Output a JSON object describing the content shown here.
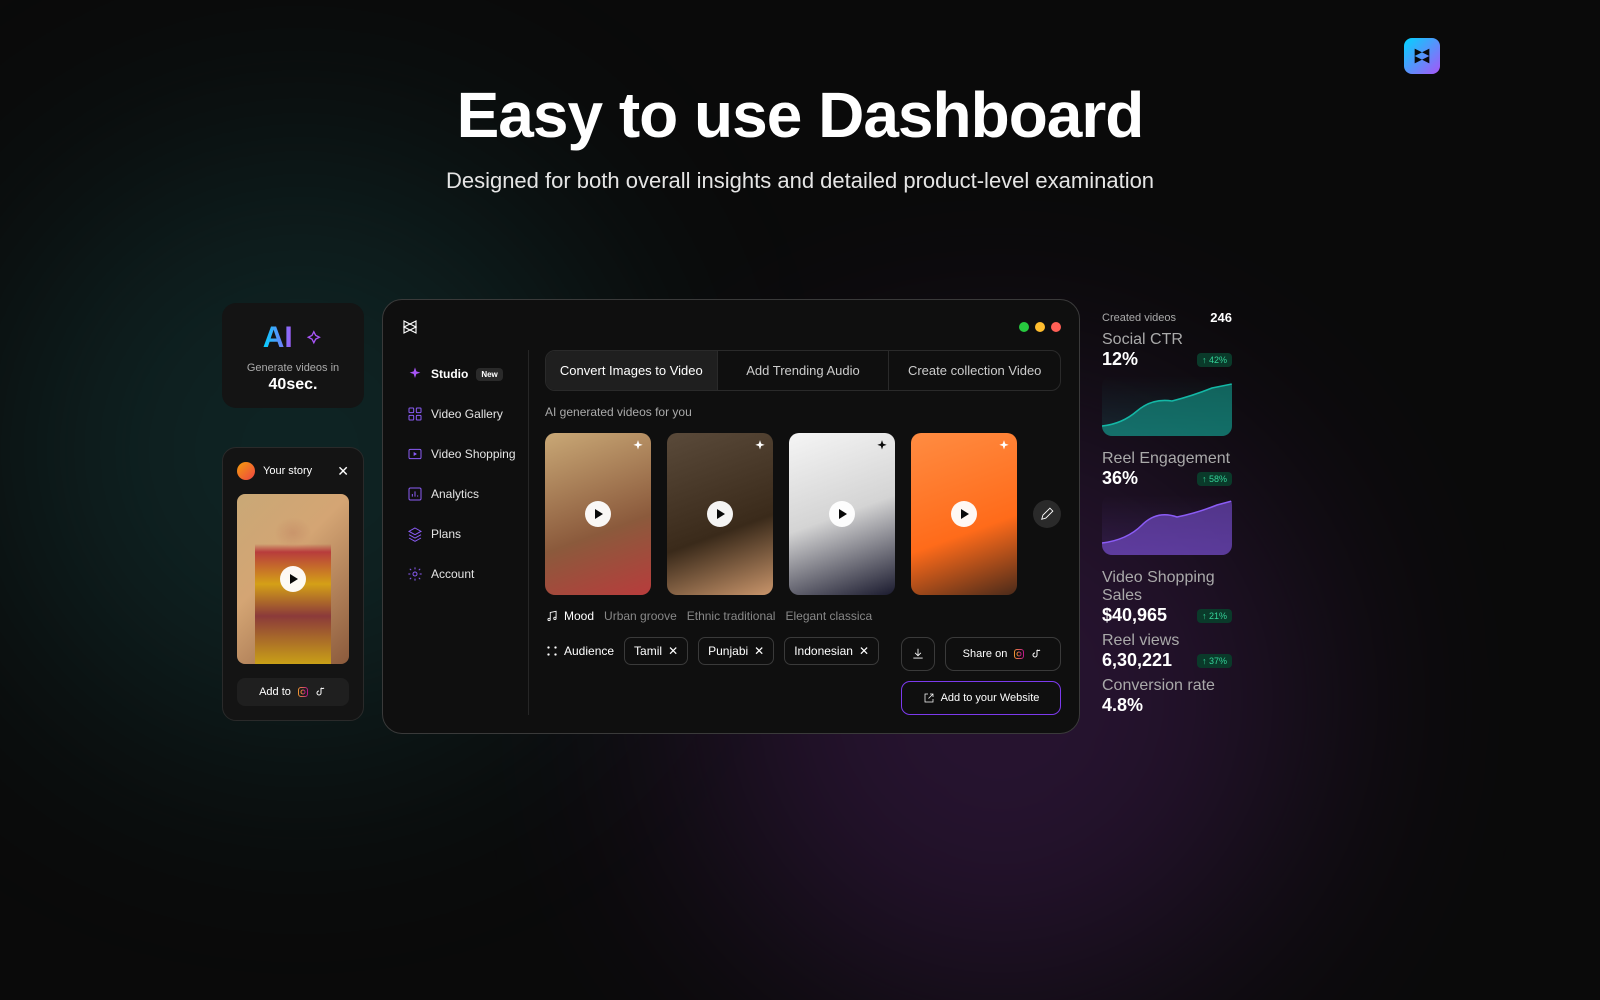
{
  "hero": {
    "title": "Easy to use Dashboard",
    "subtitle": "Designed for both overall insights and detailed product-level examination"
  },
  "ai_card": {
    "badge": "AI",
    "line1": "Generate videos in",
    "line2": "40sec."
  },
  "story": {
    "title": "Your story",
    "addto": "Add to"
  },
  "sidebar": {
    "items": [
      {
        "label": "Studio",
        "badge": "New",
        "icon": "sparkle"
      },
      {
        "label": "Video Gallery",
        "icon": "grid"
      },
      {
        "label": "Video Shopping",
        "icon": "play-box"
      },
      {
        "label": "Analytics",
        "icon": "chart"
      },
      {
        "label": "Plans",
        "icon": "layers"
      },
      {
        "label": "Account",
        "icon": "gear"
      }
    ]
  },
  "tabs": [
    "Convert Images to Video",
    "Add Trending Audio",
    "Create collection Video"
  ],
  "section_label": "AI generated videos for you",
  "mood": {
    "label": "Mood",
    "chips": [
      "Urban groove",
      "Ethnic traditional",
      "Elegant classica"
    ]
  },
  "audience": {
    "label": "Audience",
    "chips": [
      "Tamil",
      "Punjabi",
      "Indonesian"
    ]
  },
  "share": {
    "share_on": "Share on",
    "add_website": "Add to your Website"
  },
  "stats": {
    "created_videos_label": "Created videos",
    "created_videos_value": "246",
    "social_ctr_label": "Social CTR",
    "social_ctr_value": "12%",
    "social_ctr_delta": "↑ 42%",
    "reel_eng_label": "Reel Engagement",
    "reel_eng_value": "36%",
    "reel_eng_delta": "↑ 58%",
    "shopping_label": "Video Shopping Sales",
    "shopping_value": "$40,965",
    "shopping_delta": "↑ 21%",
    "reel_views_label": "Reel views",
    "reel_views_value": "6,30,221",
    "reel_views_delta": "↑ 37%",
    "conv_label": "Conversion rate",
    "conv_value": "4.8%"
  }
}
